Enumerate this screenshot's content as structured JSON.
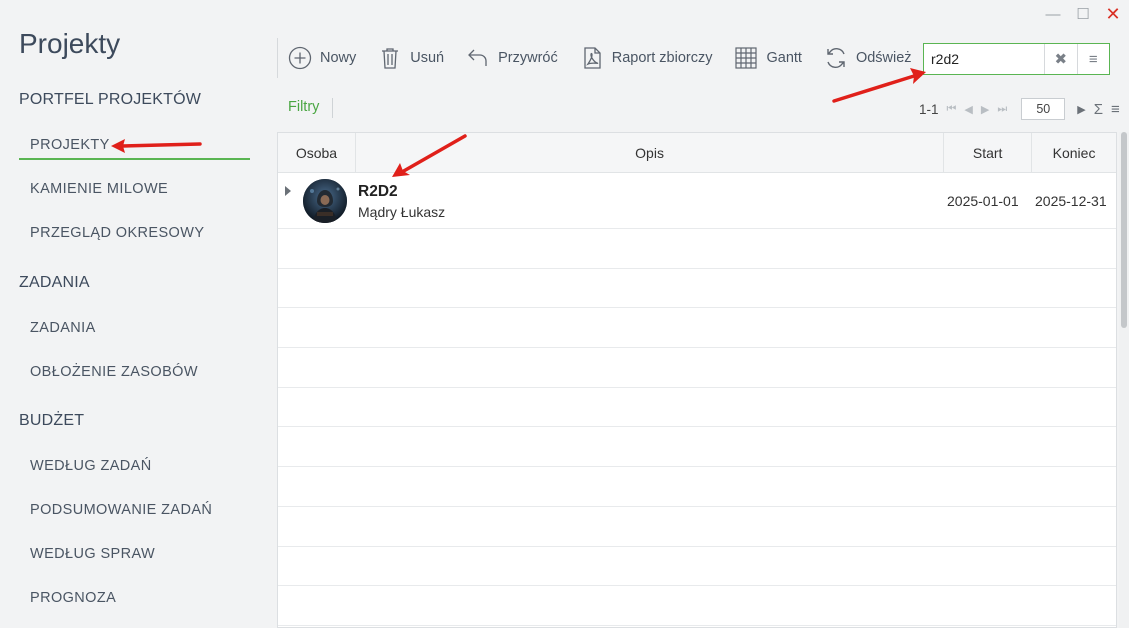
{
  "window": {
    "minimize_glyph": "—",
    "maximize_glyph": "☐",
    "close_glyph": "✕"
  },
  "sidebar": {
    "title": "Projekty",
    "sections": [
      {
        "header": "PORTFEL PROJEKTÓW",
        "items": [
          "PROJEKTY",
          "KAMIENIE MILOWE",
          "PRZEGLĄD OKRESOWY"
        ]
      },
      {
        "header": "ZADANIA",
        "items": [
          "ZADANIA",
          "OBŁOŻENIE ZASOBÓW"
        ]
      },
      {
        "header": "BUDŻET",
        "items": [
          "WEDŁUG ZADAŃ",
          "PODSUMOWANIE ZADAŃ",
          "WEDŁUG SPRAW",
          "PROGNOZA"
        ]
      }
    ],
    "active_item": "PROJEKTY"
  },
  "toolbar": {
    "new_label": "Nowy",
    "delete_label": "Usuń",
    "restore_label": "Przywróć",
    "report_label": "Raport zbiorczy",
    "gantt_label": "Gantt",
    "refresh_label": "Odśwież"
  },
  "search": {
    "value": "r2d2",
    "clear_glyph": "✖",
    "menu_glyph": "≡"
  },
  "filters_label": "Filtry",
  "pager": {
    "range": "1-1",
    "page_size": "50",
    "sigma_glyph": "Σ",
    "menu_glyph": "≡"
  },
  "grid": {
    "columns": [
      "Osoba",
      "Opis",
      "Start",
      "Koniec"
    ],
    "rows": [
      {
        "name": "R2D2",
        "owner": "Mądry Łukasz",
        "start": "2025-01-01",
        "end": "2025-12-31"
      }
    ]
  },
  "colors": {
    "accent_green": "#5ab552",
    "annotation_red": "#e0201a"
  }
}
